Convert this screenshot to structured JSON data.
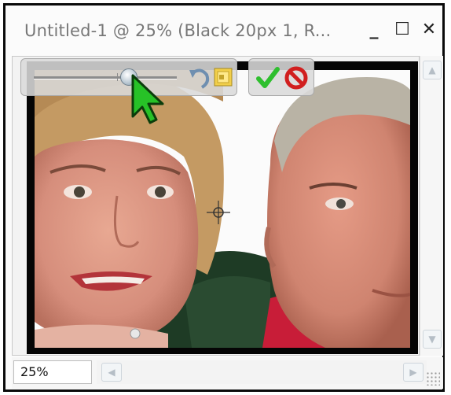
{
  "window": {
    "title": "Untitled-1 @ 25% (Black 20px 1, R...",
    "minimize_glyph": "_",
    "maximize_glyph": "☐",
    "close_glyph": "✕"
  },
  "status": {
    "zoom_value": "25%"
  },
  "toolbar": {
    "zoom_slider_value": 0.68,
    "icons": [
      "reset-rotate-icon",
      "fit-to-window-icon",
      "commit-check-icon",
      "cancel-icon"
    ]
  },
  "canvas": {
    "image": "photo of two people, woman on left, man on right"
  },
  "colors": {
    "accent_green": "#2fbf2f",
    "cancel_red": "#d11f1f"
  }
}
